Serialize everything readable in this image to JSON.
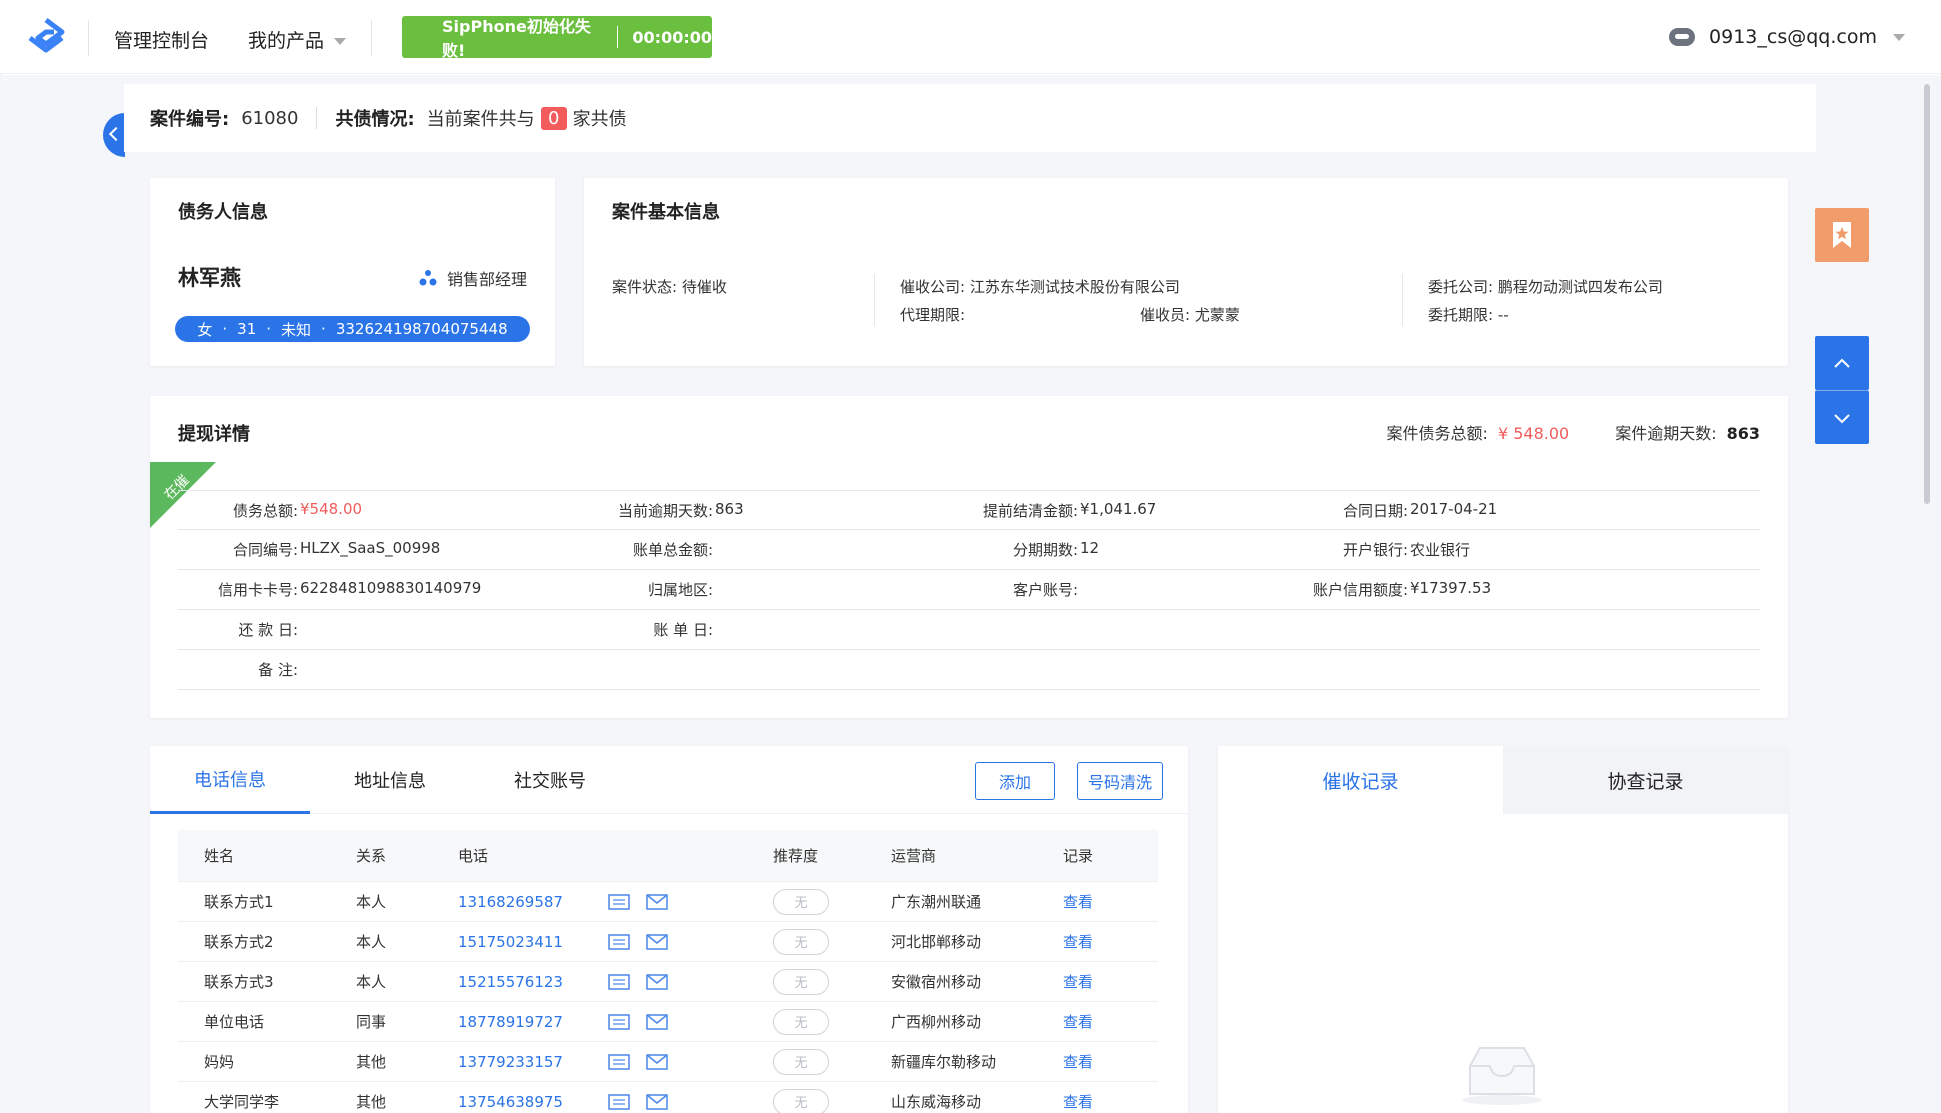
{
  "header": {
    "console": "管理控制台",
    "product": "我的产品",
    "sip_status": "SipPhone初始化失败!",
    "sip_timer": "00:00:00",
    "user_email": "0913_cs@qq.com",
    "icons": [
      "logo-icon",
      "avatar-icon",
      "chevron-down-icon"
    ]
  },
  "casebar": {
    "case_no_label": "案件编号:",
    "case_no": "61080",
    "shared_label": "共债情况:",
    "shared_prefix": "当前案件共与",
    "shared_count": "0",
    "shared_suffix": "家共债"
  },
  "debtor": {
    "title": "债务人信息",
    "name": "林军燕",
    "role": "销售部经理",
    "gender": "女",
    "age": "31",
    "marital": "未知",
    "id_no": "332624198704075448"
  },
  "case_info": {
    "title": "案件基本信息",
    "status_label": "案件状态:",
    "status": "待催收",
    "agency_label": "催收公司:",
    "agency": "江苏东华测试技术股份有限公司",
    "agent_period_label": "代理期限:",
    "agent_period": "",
    "collector_label": "催收员:",
    "collector": "尤蒙蒙",
    "client_label": "委托公司:",
    "client": "鹏程勿动测试四发布公司",
    "client_period_label": "委托期限:",
    "client_period": "--"
  },
  "withdraw": {
    "title": "提现详情",
    "total_label": "案件债务总额:",
    "total": "¥ 548.00",
    "overdue_label": "案件逾期天数:",
    "overdue": "863",
    "ribbon": "在催",
    "rows": [
      [
        {
          "k": "债务总额:",
          "v": "¥548.00",
          "red": true
        },
        {
          "k": "当前逾期天数:",
          "v": "863"
        },
        {
          "k": "提前结清金额:",
          "v": "¥1,041.67"
        },
        {
          "k": "合同日期:",
          "v": "2017-04-21"
        }
      ],
      [
        {
          "k": "合同编号:",
          "v": "HLZX_SaaS_00998"
        },
        {
          "k": "账单总金额:",
          "v": ""
        },
        {
          "k": "分期期数:",
          "v": "12"
        },
        {
          "k": "开户银行:",
          "v": "农业银行"
        }
      ],
      [
        {
          "k": "信用卡卡号:",
          "v": "6228481098830140979"
        },
        {
          "k": "归属地区:",
          "v": ""
        },
        {
          "k": "客户账号:",
          "v": ""
        },
        {
          "k": "账户信用额度:",
          "v": "¥17397.53"
        }
      ],
      [
        {
          "k": "还 款 日:",
          "v": ""
        },
        {
          "k": "账 单 日:",
          "v": ""
        }
      ],
      [
        {
          "k": "备 注:",
          "v": ""
        }
      ]
    ]
  },
  "phone": {
    "tabs": [
      "电话信息",
      "地址信息",
      "社交账号"
    ],
    "add_btn": "添加",
    "clean_btn": "号码清洗",
    "headers": [
      "姓名",
      "关系",
      "电话",
      "推荐度",
      "运营商",
      "记录"
    ],
    "rows": [
      {
        "name": "联系方式1",
        "rel": "本人",
        "tel": "13168269587",
        "rec": "无",
        "op": "广东潮州联通",
        "view": "查看"
      },
      {
        "name": "联系方式2",
        "rel": "本人",
        "tel": "15175023411",
        "rec": "无",
        "op": "河北邯郸移动",
        "view": "查看"
      },
      {
        "name": "联系方式3",
        "rel": "本人",
        "tel": "15215576123",
        "rec": "无",
        "op": "安徽宿州移动",
        "view": "查看"
      },
      {
        "name": "单位电话",
        "rel": "同事",
        "tel": "18778919727",
        "rec": "无",
        "op": "广西柳州移动",
        "view": "查看"
      },
      {
        "name": "妈妈",
        "rel": "其他",
        "tel": "13779233157",
        "rec": "无",
        "op": "新疆库尔勒移动",
        "view": "查看"
      },
      {
        "name": "大学同学李",
        "rel": "其他",
        "tel": "13754638975",
        "rec": "无",
        "op": "山东威海移动",
        "view": "查看"
      }
    ]
  },
  "records": {
    "tabs": [
      "催收记录",
      "协查记录"
    ]
  },
  "colors": {
    "primary": "#2b74e8",
    "danger": "#f25c5c",
    "success": "#6bbf3f",
    "bookmark": "#f29b6b"
  }
}
